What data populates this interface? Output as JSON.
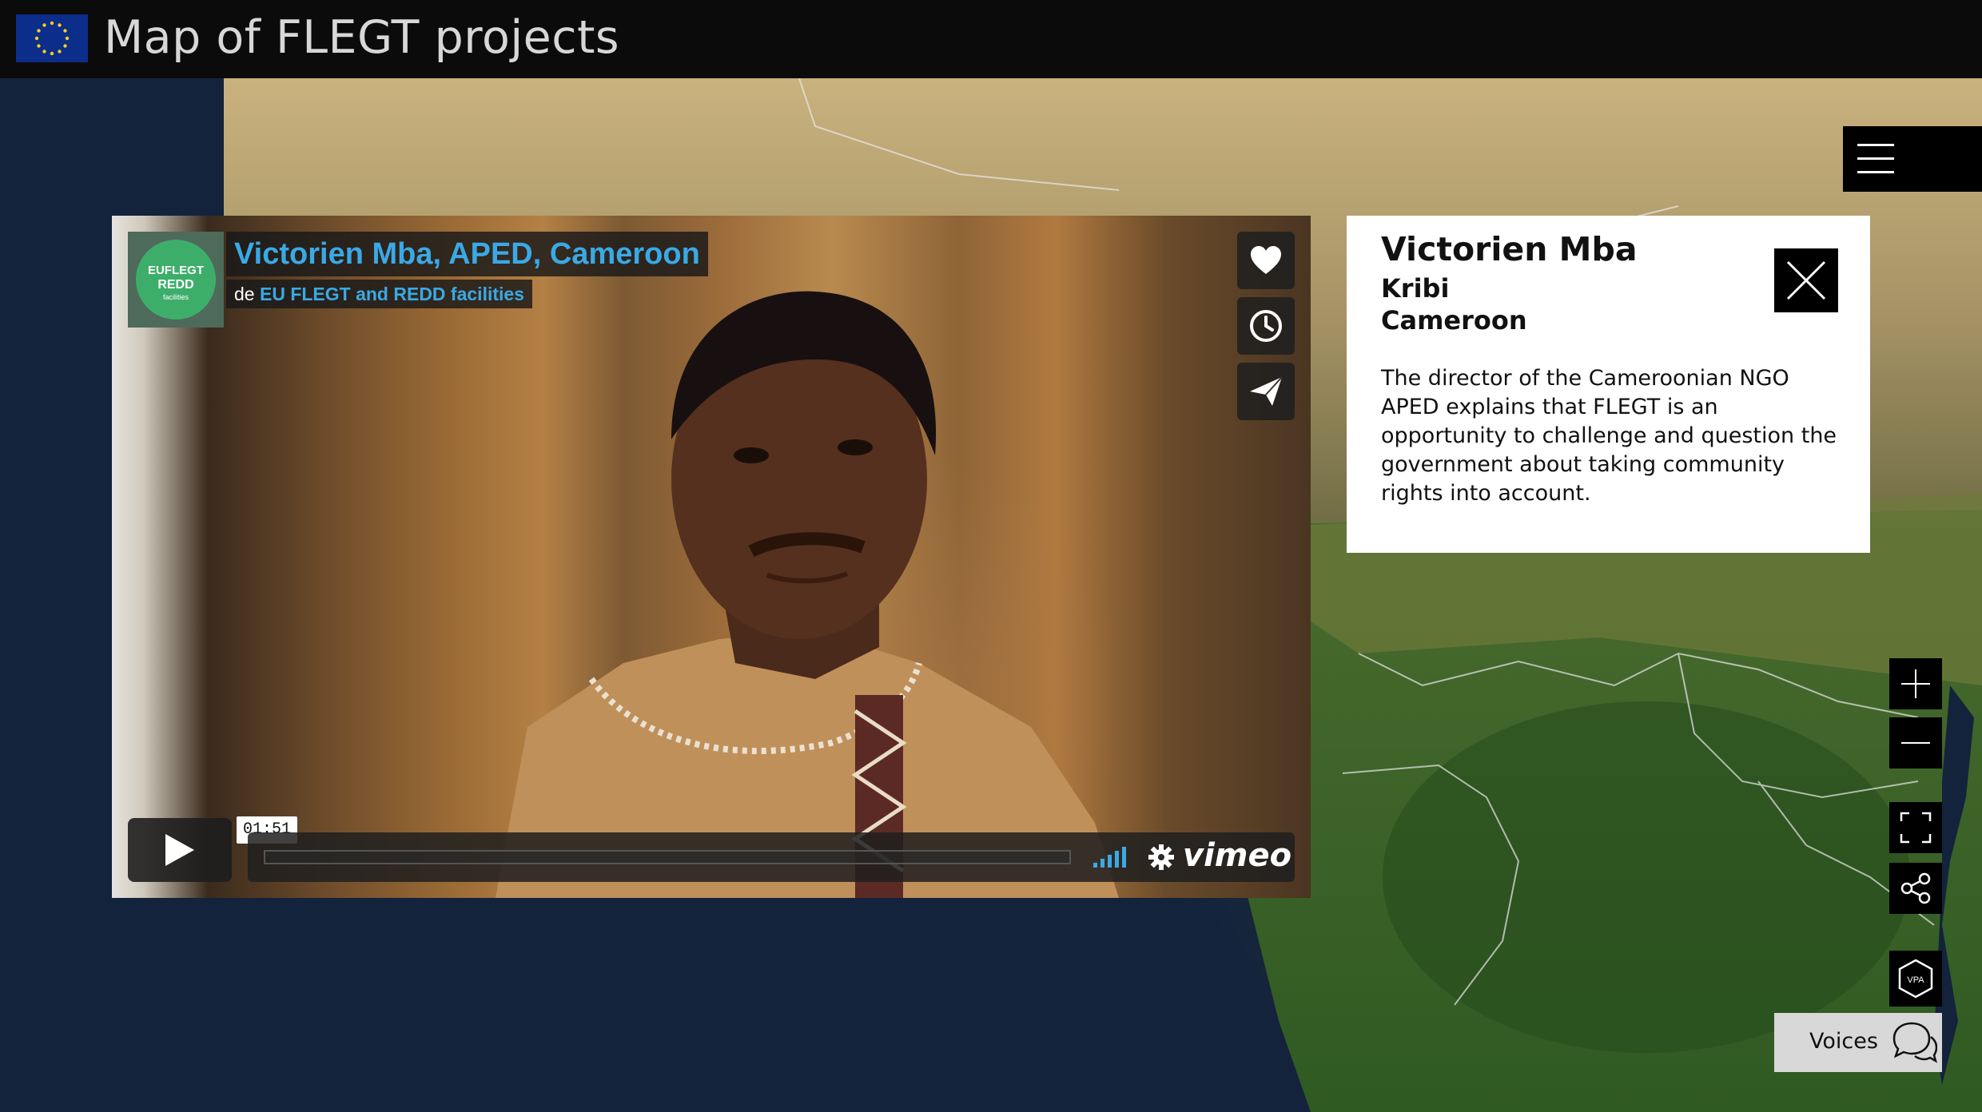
{
  "header": {
    "title": "Map of FLEGT projects"
  },
  "video": {
    "title": "Victorien Mba, APED, Cameroon",
    "byline_prefix": "de",
    "byline_channel": "EU FLEGT and REDD facilities",
    "channel_logo": {
      "line1": "EUFLEGT",
      "line2": "REDD",
      "line3": "facilities"
    },
    "time": "01:51",
    "player_brand": "vimeo",
    "icons": {
      "like": "heart-icon",
      "watch_later": "clock-icon",
      "share": "paper-plane-icon",
      "play": "play-icon",
      "volume": "volume-icon",
      "settings": "gear-icon"
    },
    "colors": {
      "title": "#3aa9e6",
      "logo_green": "#3dae6a"
    }
  },
  "info_panel": {
    "name": "Victorien Mba",
    "city": "Kribi",
    "country": "Cameroon",
    "description": "The director of the Cameroonian NGO APED explains that FLEGT is an opportunity to challenge and question the government about taking community rights into account."
  },
  "map_controls": {
    "vpa_label": "VPA",
    "voices_label": "Voices",
    "icons": {
      "menu": "hamburger-menu-icon",
      "zoom_in": "plus-icon",
      "zoom_out": "minus-icon",
      "fullscreen": "fullscreen-icon",
      "share": "share-icon",
      "vpa": "vpa-hexagon-icon",
      "voices": "speech-bubbles-icon"
    }
  }
}
